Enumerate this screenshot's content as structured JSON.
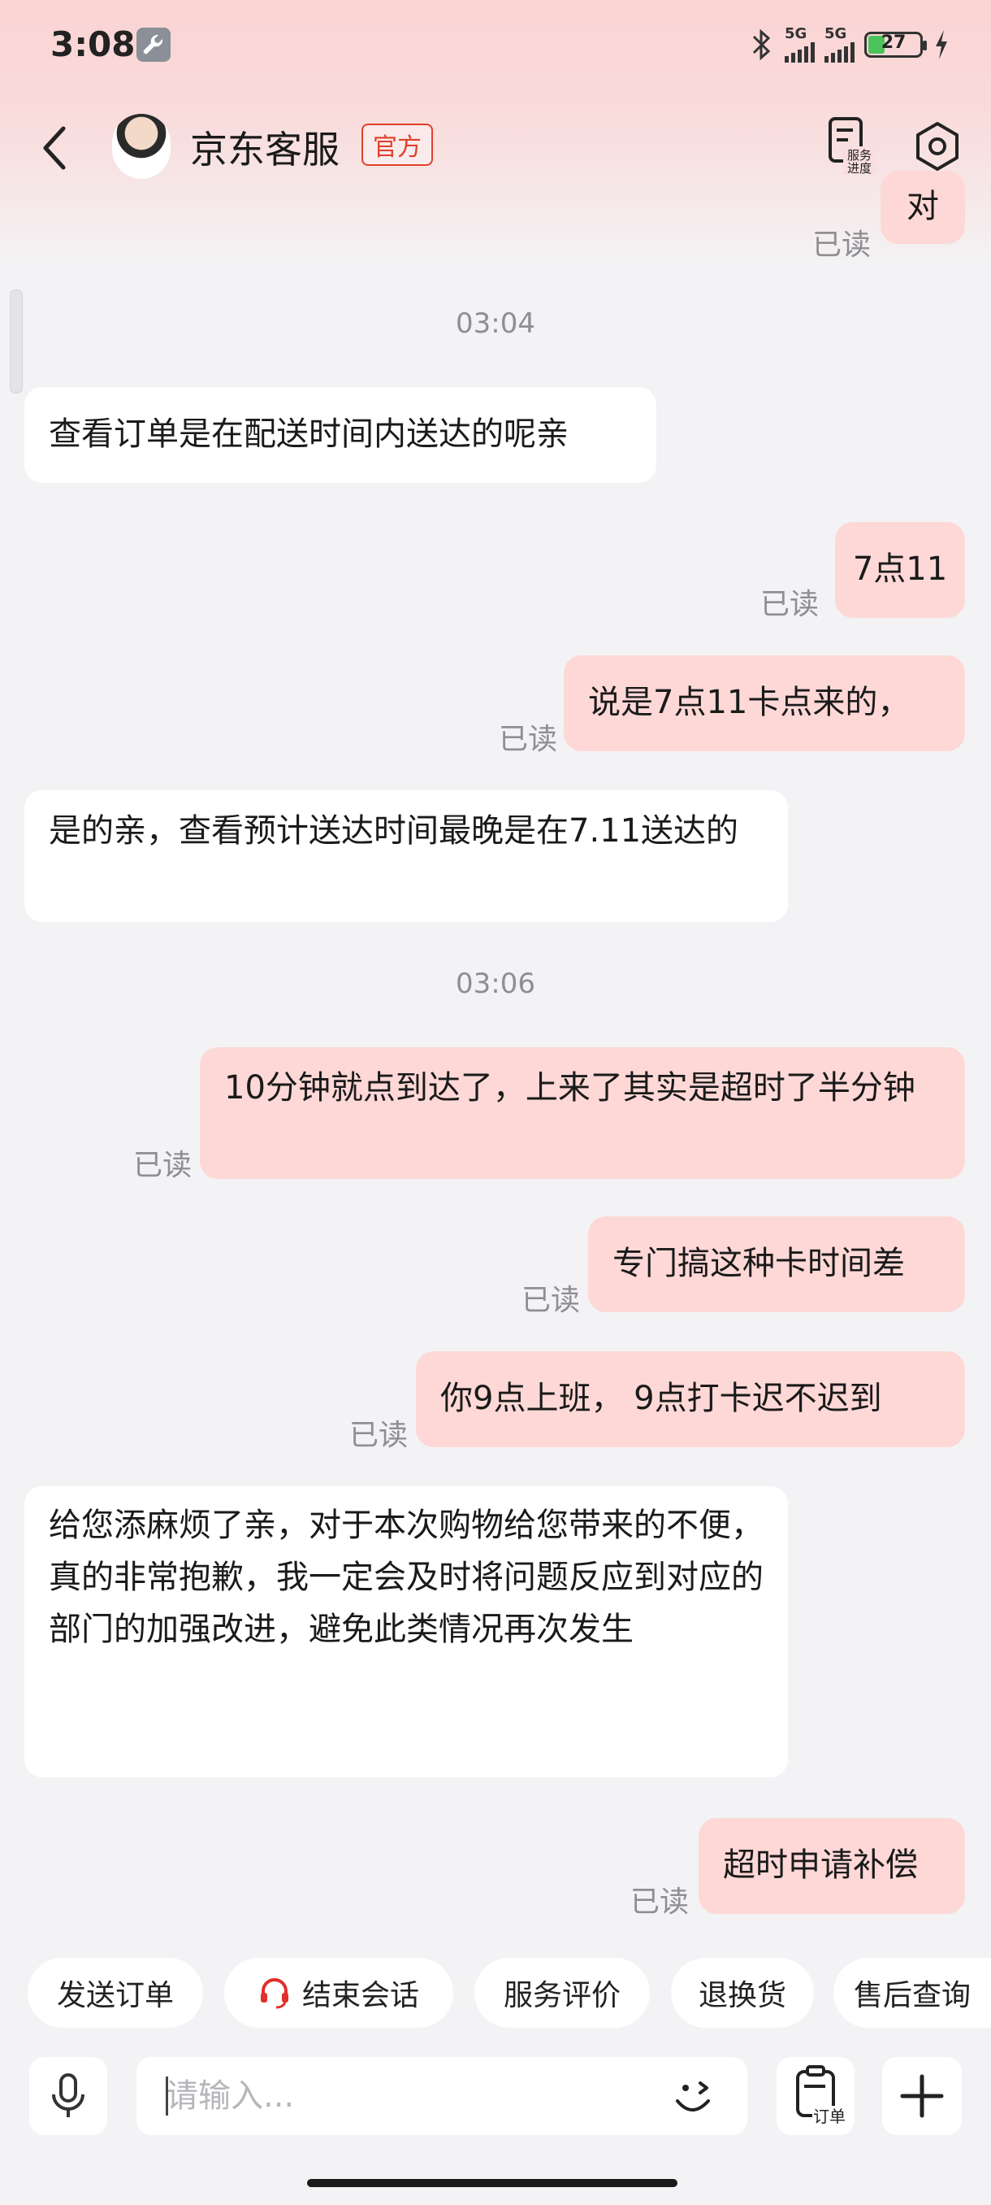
{
  "status_bar": {
    "time": "3:08",
    "sim1": "5G",
    "sim2": "5G",
    "battery": "27"
  },
  "header": {
    "title": "京东客服",
    "badge": "官方",
    "service_progress_label_1": "服务",
    "service_progress_label_2": "进度"
  },
  "chat": {
    "read_label": "已读",
    "messages": [
      {
        "side": "out",
        "text": "对",
        "read": "已读"
      },
      {
        "type": "time",
        "text": "03:04"
      },
      {
        "side": "in",
        "text": "查看订单是在配送时间内送达的呢亲"
      },
      {
        "side": "out",
        "text": "7点11",
        "read": "已读"
      },
      {
        "side": "out",
        "text": "说是7点11卡点来的，",
        "read": "已读"
      },
      {
        "side": "in",
        "text": "是的亲，查看预计送达时间最晚是在7.11送达的"
      },
      {
        "type": "time",
        "text": "03:06"
      },
      {
        "side": "out",
        "text": "10分钟就点到达了，上来了其实是超时了半分钟",
        "read": "已读"
      },
      {
        "side": "out",
        "text": "专门搞这种卡时间差",
        "read": "已读"
      },
      {
        "side": "out",
        "text": "你9点上班， 9点打卡迟不迟到",
        "read": "已读"
      },
      {
        "side": "in",
        "text": "给您添麻烦了亲，对于本次购物给您带来的不便，真的非常抱歉，我一定会及时将问题反应到对应的部门的加强改进，避免此类情况再次发生"
      },
      {
        "side": "out",
        "text": "超时申请补偿",
        "read": "已读"
      }
    ]
  },
  "quick_actions": [
    "发送订单",
    "结束会话",
    "服务评价",
    "退换货",
    "售后查询"
  ],
  "input": {
    "placeholder": "请输入...",
    "order_label": "订单"
  },
  "colors": {
    "accent": "#e0402a",
    "out_bubble": "#fdd8d6",
    "in_bubble": "#ffffff",
    "headset": "#e0302a"
  }
}
